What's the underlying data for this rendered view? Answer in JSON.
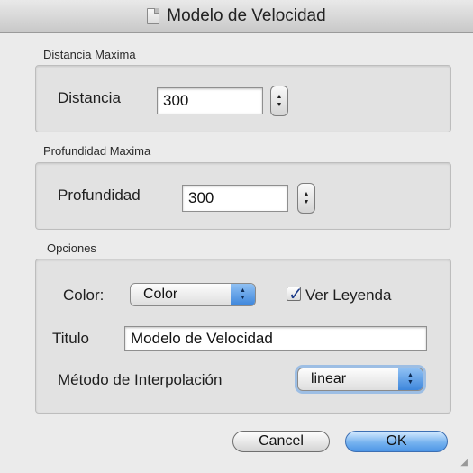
{
  "window": {
    "title": "Modelo de Velocidad",
    "title_icon": "document-icon"
  },
  "distance": {
    "section_label": "Distancia Maxima",
    "field_label": "Distancia",
    "value": "300"
  },
  "depth": {
    "section_label": "Profundidad Maxima",
    "field_label": "Profundidad",
    "value": "300"
  },
  "options": {
    "section_label": "Opciones",
    "color_label": "Color:",
    "color_selected": "Color",
    "legend_label": "Ver Leyenda",
    "legend_checked": true,
    "title_label": "Titulo",
    "title_value": "Modelo de Velocidad",
    "interp_label": "Método de Interpolación",
    "interp_selected": "linear"
  },
  "buttons": {
    "cancel": "Cancel",
    "ok": "OK"
  },
  "colors": {
    "window_bg": "#ebebeb",
    "accent_blue": "#4d95e6"
  }
}
